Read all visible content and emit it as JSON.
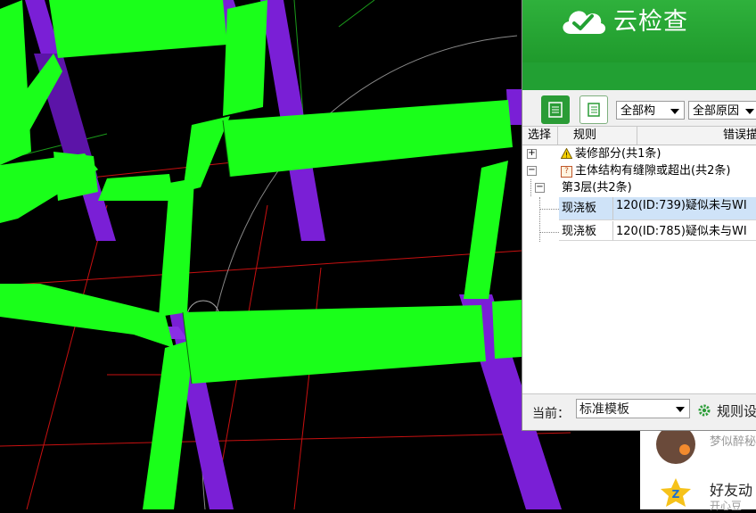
{
  "app": {
    "title": "云检查"
  },
  "toolbar": {
    "filter_component": "全部构",
    "filter_rule": "全部原因"
  },
  "grid": {
    "columns": [
      "选择",
      "规则",
      "错误描"
    ],
    "rows": [
      {
        "expander": "+",
        "icon": "warning-icon",
        "text": "装修部分(共1条)"
      },
      {
        "expander": "−",
        "icon": "question-icon",
        "text": "主体结构有缝隙或超出(共2条)"
      },
      {
        "expander": "−",
        "icon": "",
        "text": "第3层(共2条)"
      },
      {
        "col1": "现浇板",
        "col2": "120(ID:739)疑似未与WI"
      },
      {
        "col1": "现浇板",
        "col2": "120(ID:785)疑似未与WI"
      }
    ]
  },
  "status": {
    "current_label": "当前：",
    "template_value": "标准模板",
    "rule_settings_label": "规则设"
  },
  "background_app": {
    "item1_sub": "梦似醉秘",
    "item2_title": "好友动",
    "item2_sub": "开心豆"
  },
  "colors": {
    "beam_green": "#1aff1a",
    "column_purple": "#7a1fd6",
    "header_green": "#2aa83a",
    "grid_red": "#d01010",
    "selected_row": "#cfe3f8"
  }
}
